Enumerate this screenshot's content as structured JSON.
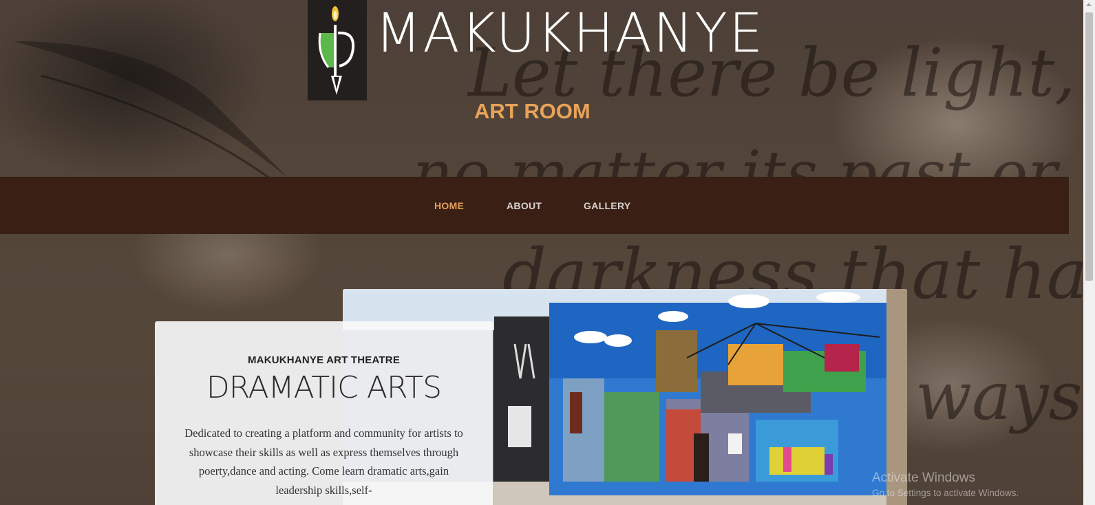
{
  "header": {
    "brand": "MAKUKHANYE",
    "subtitle": "ART ROOM"
  },
  "nav": {
    "items": [
      {
        "label": "HOME",
        "active": true
      },
      {
        "label": "ABOUT",
        "active": false
      },
      {
        "label": "GALLERY",
        "active": false
      }
    ]
  },
  "hero": {
    "kicker": "MAKUKHANYE ART THEATRE",
    "title": "DRAMATIC ARTS",
    "body": "Dedicated to creating a platform and community for artists to showcase their skills as well as express themselves through poerty,dance and acting. Come learn dramatic arts,gain leadership skills,self-"
  },
  "os_watermark": {
    "line1": "Activate Windows",
    "line2": "Go to Settings to activate Windows."
  },
  "colors": {
    "accent": "#e8a35a",
    "navbar": "#3a1f14",
    "logo_bg": "#231f1e",
    "logo_green": "#5cb84a"
  },
  "icons": {
    "logo": "candle-pen-mask-logo"
  }
}
